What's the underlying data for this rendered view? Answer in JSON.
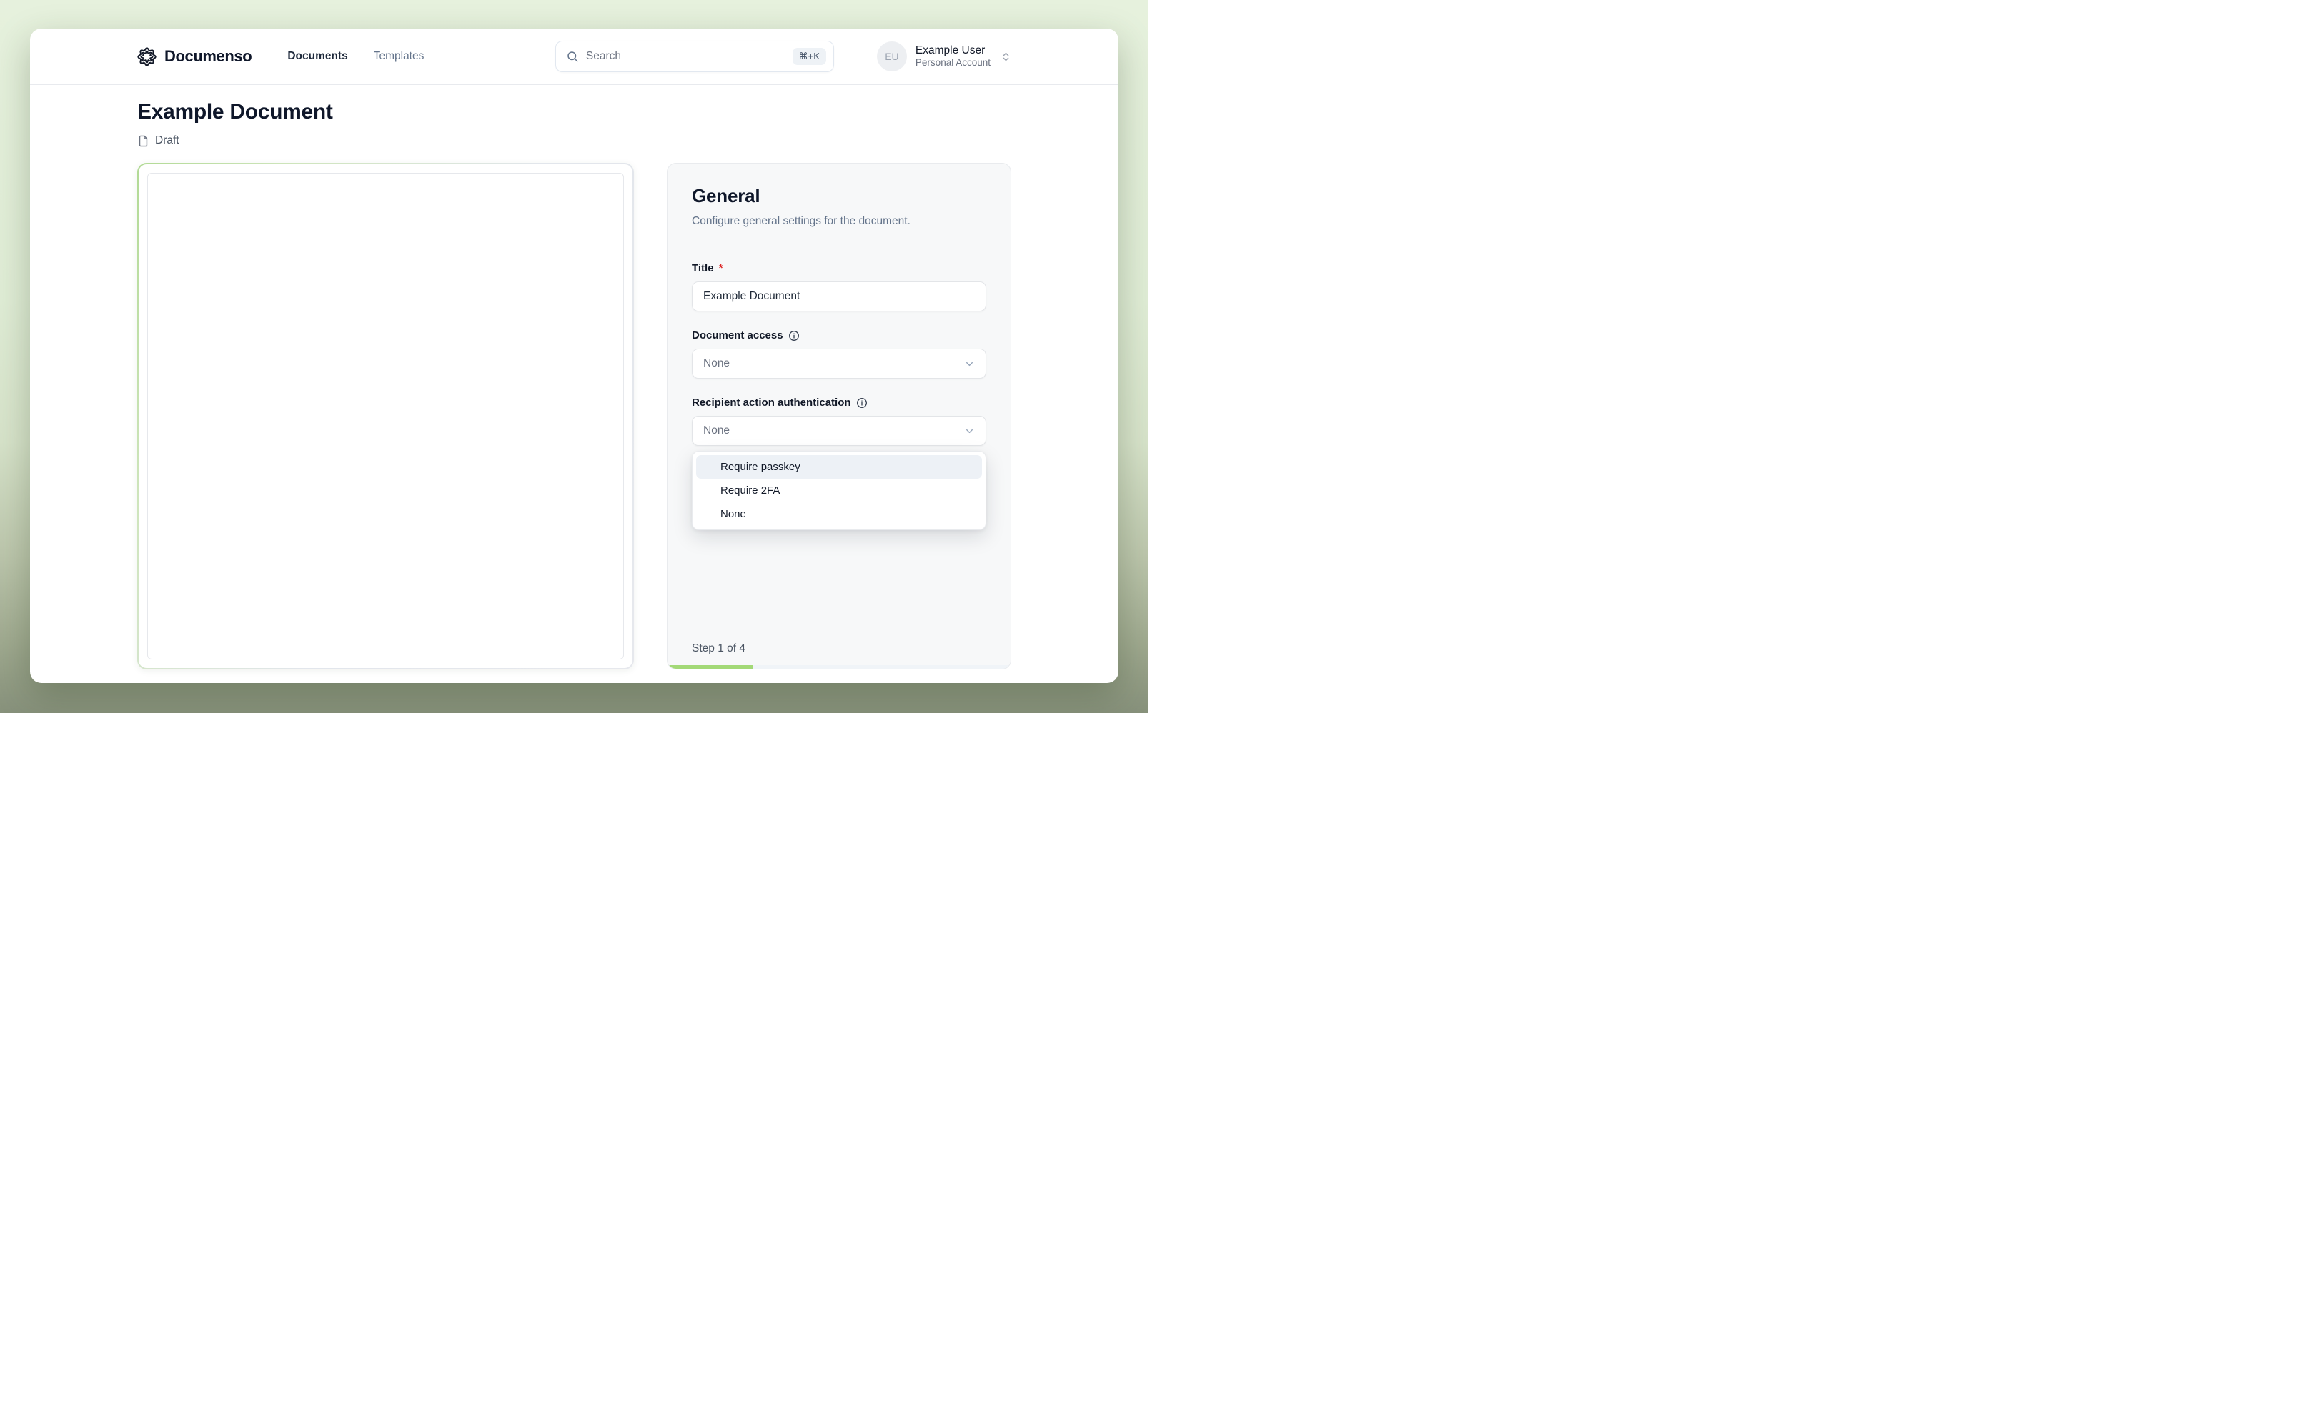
{
  "nav": {
    "brand": "Documenso",
    "links": [
      {
        "label": "Documents"
      },
      {
        "label": "Templates"
      }
    ],
    "search": {
      "placeholder": "Search",
      "shortcut": "⌘+K"
    },
    "user": {
      "initials": "EU",
      "name": "Example User",
      "account_type": "Personal Account"
    }
  },
  "document": {
    "title": "Example Document",
    "status": "Draft"
  },
  "settings_panel": {
    "title": "General",
    "description": "Configure general settings for the document.",
    "fields": {
      "title": {
        "label": "Title",
        "required_mark": "*",
        "value": "Example Document"
      },
      "document_access": {
        "label": "Document access",
        "value": "None"
      },
      "recipient_auth": {
        "label": "Recipient action authentication",
        "value": "None",
        "options": [
          "Require passkey",
          "Require 2FA",
          "None"
        ],
        "highlighted_option": "Require passkey"
      }
    },
    "stepper": {
      "label": "Step 1 of 4",
      "progress_percent": 25
    }
  },
  "colors": {
    "accent_green": "#a3d977",
    "brand_dark": "#0f172a",
    "menu_highlight": "#edf1f6",
    "background_green_top": "#e6f1dd",
    "background_green_bottom": "#87917b"
  }
}
